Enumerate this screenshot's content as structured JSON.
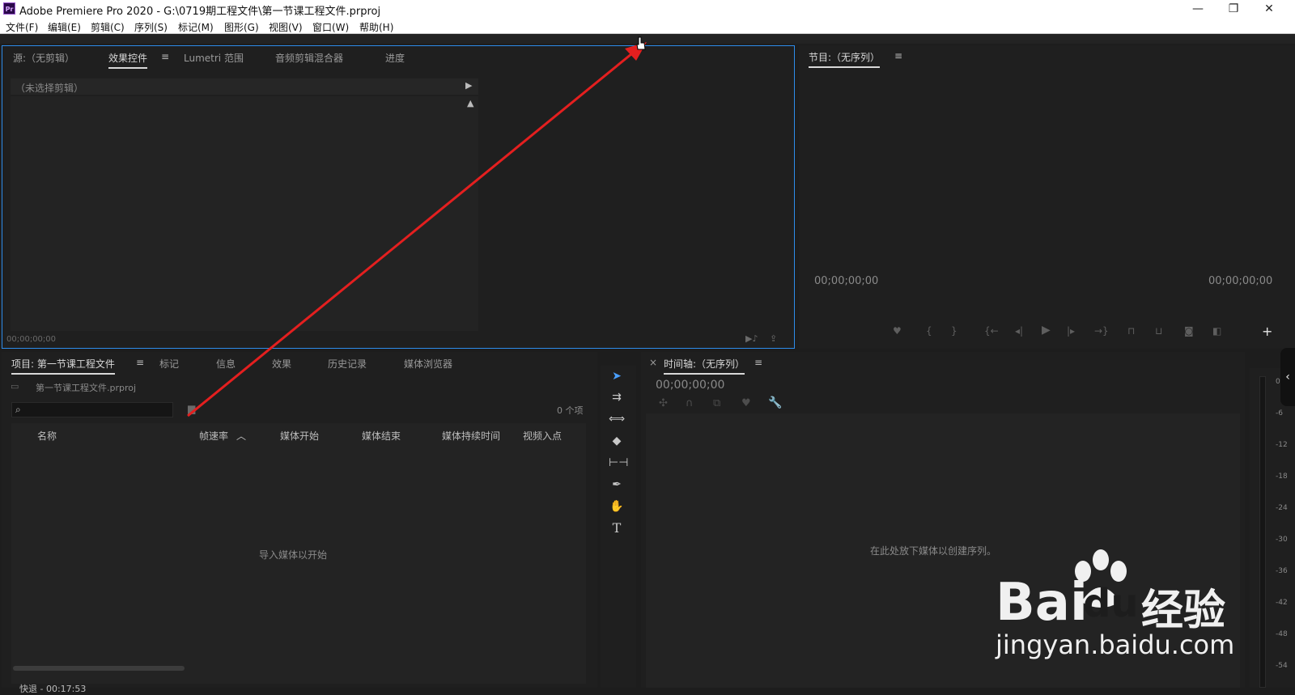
{
  "window": {
    "app_badge": "Pr",
    "title": "Adobe Premiere Pro 2020 - G:\\0719期工程文件\\第一节课工程文件.prproj",
    "minimize_glyph": "—",
    "maximize_glyph": "❐",
    "close_glyph": "✕"
  },
  "menu": [
    "文件(F)",
    "编辑(E)",
    "剪辑(C)",
    "序列(S)",
    "标记(M)",
    "图形(G)",
    "视图(V)",
    "窗口(W)",
    "帮助(H)"
  ],
  "source_panel": {
    "tabs": [
      "源:（无剪辑）",
      "效果控件",
      "Lumetri 范围",
      "音频剪辑混合器",
      "进度"
    ],
    "menu_glyph": "≡",
    "no_clip_label": "（未选择剪辑）",
    "timecode": "00;00;00;00"
  },
  "program_panel": {
    "title": "节目:（无序列）",
    "menu_glyph": "≡",
    "timecode_left": "00;00;00;00",
    "timecode_right": "00;00;00;00",
    "add_glyph": "+"
  },
  "project_panel": {
    "tabs": [
      "项目: 第一节课工程文件",
      "标记",
      "信息",
      "效果",
      "历史记录",
      "媒体浏览器"
    ],
    "menu_glyph": "≡",
    "project_file": "第一节课工程文件.prproj",
    "search_placeholder": "",
    "item_count": "0 个项",
    "columns": [
      "名称",
      "帧速率",
      "媒体开始",
      "媒体结束",
      "媒体持续时间",
      "视频入点"
    ],
    "sort_glyph": "︿",
    "empty_message": "导入媒体以开始",
    "footer_partial": "快退 - 00:17:53"
  },
  "timeline_panel": {
    "close_glyph": "×",
    "title": "时间轴:（无序列）",
    "menu_glyph": "≡",
    "timecode": "00;00;00;00",
    "empty_message": "在此处放下媒体以创建序列。"
  },
  "audio_meter": {
    "labels": [
      "0",
      "-6",
      "-12",
      "-18",
      "-24",
      "-30",
      "-36",
      "-42",
      "-48",
      "-54"
    ]
  },
  "watermark": {
    "brand_a": "Bai",
    "brand_b": "du",
    "brand_cn": "经验",
    "url": "jingyan.baidu.com"
  },
  "colors": {
    "accent_blue": "#2d8ceb",
    "annotation_red": "#e41f1f",
    "panel_bg": "#1f1f1f",
    "app_bg": "#1d1d1d"
  }
}
